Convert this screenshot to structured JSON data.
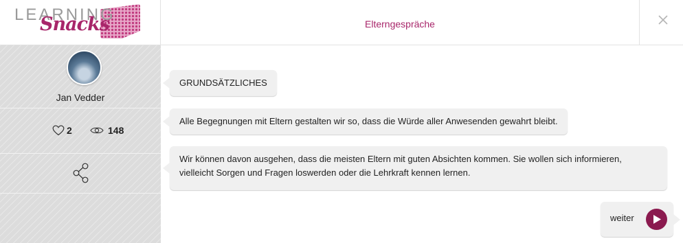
{
  "header": {
    "logo_word1": "LEARNING",
    "logo_word2": "Snacks",
    "title": "Elterngespräche"
  },
  "sidebar": {
    "author_name": "Jan Vedder",
    "likes": "2",
    "views": "148"
  },
  "chat": {
    "messages": [
      "GRUNDSÄTZLICHES",
      "Alle Begegnungen mit Eltern gestalten wir so, dass die Würde aller Anwesenden gewahrt bleibt.",
      "Wir können davon ausgehen, dass die meisten Eltern mit guten Absichten kommen. Sie wollen sich informieren, vielleicht Sorgen und Fragen loswerden oder die Lehrkraft kennen lernen."
    ],
    "next_label": "weiter"
  },
  "colors": {
    "accent": "#a8266a",
    "button": "#8b1a4f"
  }
}
